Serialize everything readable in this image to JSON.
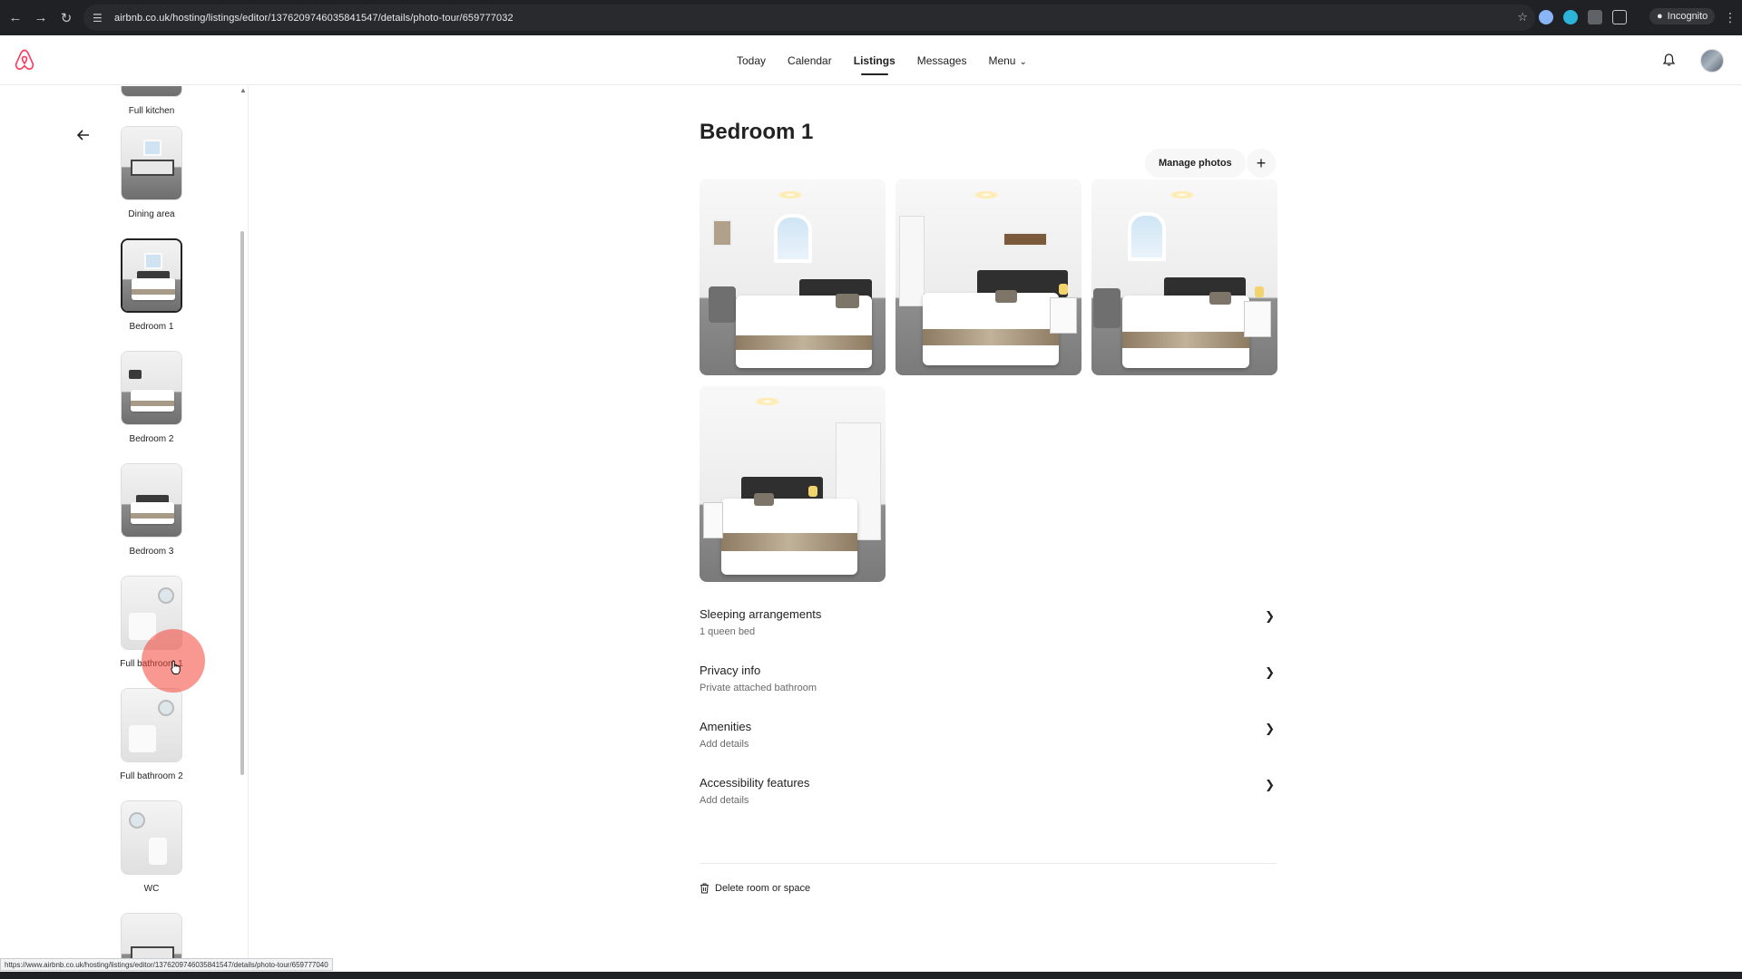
{
  "browser": {
    "url": "airbnb.co.uk/hosting/listings/editor/1376209746035841547/details/photo-tour/659777032",
    "incognito_label": "Incognito",
    "status_url": "https://www.airbnb.co.uk/hosting/listings/editor/1376209746035841547/details/photo-tour/659777040"
  },
  "nav": {
    "links": [
      "Today",
      "Calendar",
      "Listings",
      "Messages",
      "Menu"
    ],
    "active": "Listings",
    "brand_color": "#FF385C"
  },
  "sidebar": {
    "rooms": [
      {
        "label": "Full kitchen"
      },
      {
        "label": "Dining area"
      },
      {
        "label": "Bedroom 1",
        "selected": true
      },
      {
        "label": "Bedroom 2"
      },
      {
        "label": "Bedroom 3"
      },
      {
        "label": "Full bathroom 1"
      },
      {
        "label": "Full bathroom 2"
      },
      {
        "label": "WC"
      }
    ]
  },
  "main": {
    "title": "Bedroom 1",
    "manage_photos": "Manage photos",
    "photo_count": 4,
    "sections": [
      {
        "title": "Sleeping arrangements",
        "subtitle": "1 queen bed"
      },
      {
        "title": "Privacy info",
        "subtitle": "Private attached bathroom"
      },
      {
        "title": "Amenities",
        "subtitle": "Add details"
      },
      {
        "title": "Accessibility features",
        "subtitle": "Add details"
      }
    ],
    "delete_label": "Delete room or space"
  },
  "icons": {
    "back": "arrow-left-icon",
    "add": "plus-icon",
    "chevron": "chevron-right-icon",
    "trash": "trash-icon",
    "bell": "bell-icon"
  }
}
